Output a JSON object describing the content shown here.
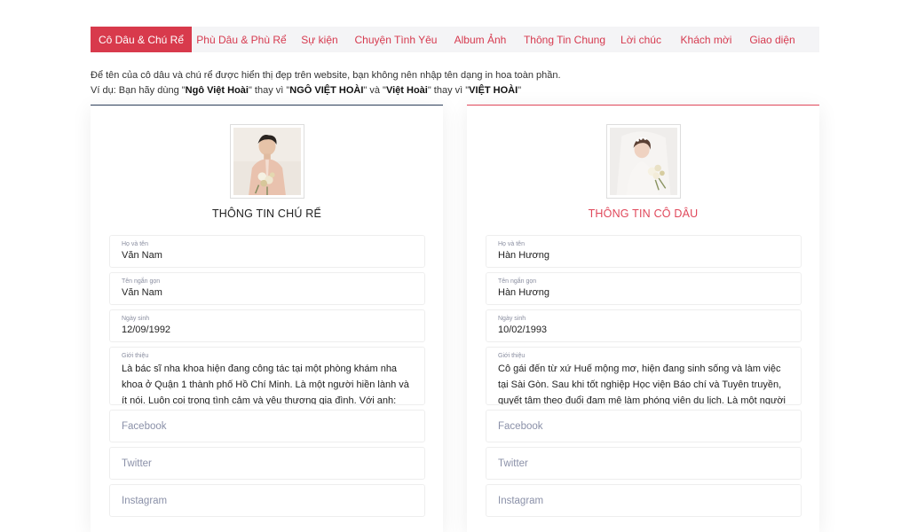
{
  "tabs": [
    {
      "label": "Cô Dâu & Chú Rể",
      "active": true
    },
    {
      "label": "Phù Dâu & Phù Rể"
    },
    {
      "label": "Sự kiện"
    },
    {
      "label": "Chuyện Tình Yêu"
    },
    {
      "label": "Album Ảnh"
    },
    {
      "label": "Thông Tin Chung"
    },
    {
      "label": "Lời chúc"
    },
    {
      "label": "Khách mời"
    },
    {
      "label": "Giao diện"
    }
  ],
  "intro": {
    "line1": "Để tên của cô dâu và chú rể được hiển thị đẹp trên website, bạn không nên nhập tên dạng in hoa toàn phần.",
    "line2_a": "Ví dụ: Bạn hãy dùng \"",
    "line2_b": "Ngô Việt Hoài",
    "line2_c": "\" thay vì \"",
    "line2_d": "NGÔ VIỆT HOÀI",
    "line2_e": "\" và \"",
    "line2_f": "Việt Hoài",
    "line2_g": "\" thay vì \"",
    "line2_h": "VIỆT HOÀI",
    "line2_i": "\""
  },
  "groom": {
    "title": "THÔNG TIN CHÚ RỂ",
    "full_name_label": "Họ và tên",
    "full_name": "Văn Nam",
    "short_name_label": "Tên ngắn gọn",
    "short_name": "Văn Nam",
    "birthday_label": "Ngày sinh",
    "birthday": "12/09/1992",
    "bio_label": "Giới thiệu",
    "bio": "Là bác sĩ nha khoa hiện đang công tác tại một phòng khám nha khoa ở Quận 1 thành phố Hồ Chí Minh. Là một người hiền lành và ít nói. Luôn coi trọng tình cảm và yêu thương gia đình. Với anh: \"Gia",
    "facebook_placeholder": "Facebook",
    "twitter_placeholder": "Twitter",
    "instagram_placeholder": "Instagram"
  },
  "bride": {
    "title": "THÔNG TIN CÔ DÂU",
    "full_name_label": "Họ và tên",
    "full_name": "Hàn Hương",
    "short_name_label": "Tên ngắn gọn",
    "short_name": "Hàn Hương",
    "birthday_label": "Ngày sinh",
    "birthday": "10/02/1993",
    "bio_label": "Giới thiệu",
    "bio": "Cô gái đến từ xứ Huế mộng mơ, hiện đang sinh sống và làm việc tại Sài Gòn. Sau khi tốt nghiệp Học viện Báo chí và Tuyên truyền, quyết tâm theo đuổi đam mê làm phóng viên du lịch. Là một người hay cười",
    "facebook_placeholder": "Facebook",
    "twitter_placeholder": "Twitter",
    "instagram_placeholder": "Instagram"
  },
  "colors": {
    "accent": "#d83a4c",
    "groom_border": "#2c3e5a",
    "bride_border": "#e0475a"
  }
}
